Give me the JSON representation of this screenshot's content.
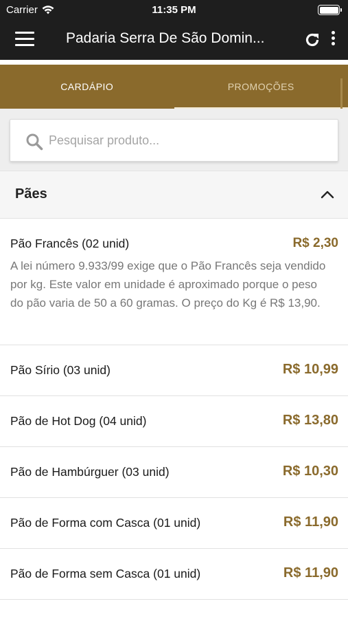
{
  "status_bar": {
    "carrier": "Carrier",
    "time": "11:35 PM",
    "battery_level": 1.0
  },
  "app_bar": {
    "title": "Padaria Serra De São Domin...",
    "icons": [
      "menu-icon",
      "refresh-icon",
      "more-vertical-icon"
    ]
  },
  "tabs": [
    {
      "label": "CARDÁPIO",
      "active": true
    },
    {
      "label": "PROMOÇÕES",
      "active": false
    }
  ],
  "search": {
    "placeholder": "Pesquisar produto...",
    "value": ""
  },
  "section": {
    "title": "Pães",
    "expanded": true
  },
  "products": [
    {
      "name": "Pão Francês (02 unid)",
      "price": "R$ 2,30",
      "description": "A lei número 9.933/99 exige que o Pão Francês seja vendido por kg. Este valor em unidade é aproximado porque o peso do pão varia de 50 a 60 gramas. O preço do Kg é R$ 13,90."
    },
    {
      "name": "Pão Sírio (03 unid)",
      "price": "R$ 10,99"
    },
    {
      "name": "Pão de Hot Dog (04 unid)",
      "price": "R$ 13,80"
    },
    {
      "name": "Pão de Hambúrguer (03 unid)",
      "price": "R$ 10,30"
    },
    {
      "name": "Pão de Forma com Casca (01 unid)",
      "price": "R$ 11,90"
    },
    {
      "name": "Pão de Forma sem Casca (01 unid)",
      "price": "R$ 11,90"
    }
  ],
  "colors": {
    "accent": "#8a6a2c",
    "app_bar": "#1e1e1e",
    "price": "#8a6a2c"
  }
}
